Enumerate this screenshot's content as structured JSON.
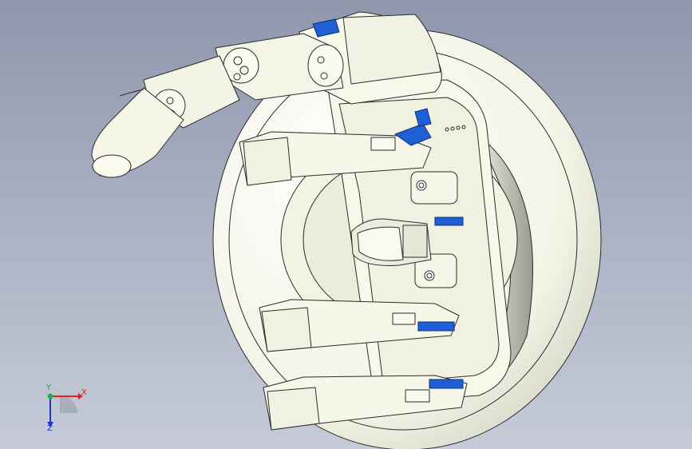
{
  "viewport": {
    "background_top": "#8f97ad",
    "background_bottom": "#c6cbd8",
    "model_color": "#fbfbed",
    "edge_color": "#2b2b2b",
    "accent_color": "#1f5fd4"
  },
  "triad": {
    "x_label": "X",
    "y_label": "Y",
    "z_label": "Z",
    "x_color": "#e02020",
    "y_color": "#19b54a",
    "z_color": "#2233cc"
  }
}
